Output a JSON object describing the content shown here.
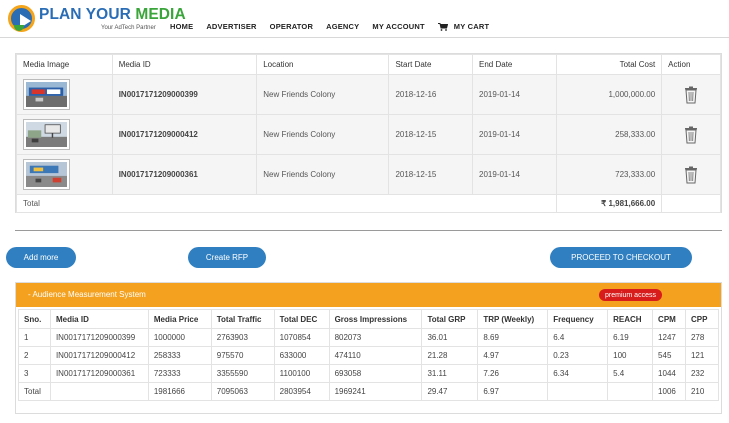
{
  "brand": {
    "name_part1": "PLAN YOUR ",
    "name_part2": "MEDIA",
    "tagline": "Your AdTech Partner",
    "colors": {
      "blue": "#2a6db5",
      "green": "#3aa53a",
      "orange": "#f4a51c"
    }
  },
  "nav": {
    "items": [
      "HOME",
      "ADVERTISER",
      "OPERATOR",
      "AGENCY",
      "MY ACCOUNT"
    ],
    "cart_label": "MY CART",
    "cart_icon": "cart-icon"
  },
  "cart": {
    "headers": [
      "Media Image",
      "Media ID",
      "Location",
      "Start Date",
      "End Date",
      "Total Cost",
      "Action"
    ],
    "rows": [
      {
        "media_id": "IN0017171209000399",
        "location": "New Friends Colony",
        "start": "2018-12-16",
        "end": "2019-01-14",
        "cost": "1,000,000.00"
      },
      {
        "media_id": "IN0017171209000412",
        "location": "New Friends Colony",
        "start": "2018-12-15",
        "end": "2019-01-14",
        "cost": "258,333.00"
      },
      {
        "media_id": "IN0017171209000361",
        "location": "New Friends Colony",
        "start": "2018-12-15",
        "end": "2019-01-14",
        "cost": "723,333.00"
      }
    ],
    "total_label": "Total",
    "total_value": "₹ 1,981,666.00",
    "action_icon": "trash-icon"
  },
  "buttons": {
    "add_more": "Add more",
    "create_rfp": "Create RFP",
    "checkout": "PROCEED TO CHECKOUT",
    "color": "#2f7fc1"
  },
  "audience": {
    "title": "-     Audience Measurement System",
    "badge": "premium access",
    "header_color": "#f4a11f",
    "badge_color": "#d81b1b",
    "headers": [
      "Sno.",
      "Media ID",
      "Media Price",
      "Total Traffic",
      "Total DEC",
      "Gross Impressions",
      "Total GRP",
      "TRP (Weekly)",
      "Frequency",
      "REACH",
      "CPM",
      "CPP"
    ],
    "rows": [
      [
        "1",
        "IN0017171209000399",
        "1000000",
        "2763903",
        "1070854",
        "802073",
        "36.01",
        "8.69",
        "6.4",
        "6.19",
        "1247",
        "278"
      ],
      [
        "2",
        "IN0017171209000412",
        "258333",
        "975570",
        "633000",
        "474110",
        "21.28",
        "4.97",
        "0.23",
        "100",
        "545",
        "121"
      ],
      [
        "3",
        "IN0017171209000361",
        "723333",
        "3355590",
        "1100100",
        "693058",
        "31.11",
        "7.26",
        "6.34",
        "5.4",
        "1044",
        "232"
      ],
      [
        "Total",
        "",
        "1981666",
        "7095063",
        "2803954",
        "1969241",
        "29.47",
        "6.97",
        "",
        "",
        "1006",
        "210"
      ]
    ]
  }
}
